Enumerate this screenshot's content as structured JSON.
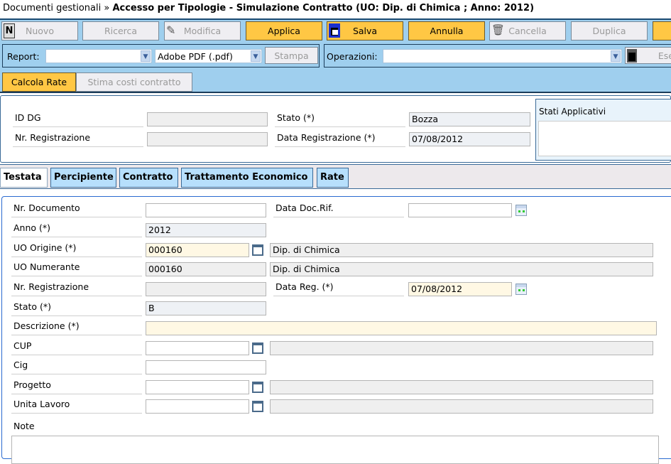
{
  "title": {
    "prefix": "Documenti gestionali »",
    "main": "Accesso per Tipologie - Simulazione Contratto (UO: Dip. di Chimica ; Anno: 2012)"
  },
  "toolbar": {
    "nuovo": "Nuovo",
    "ricerca": "Ricerca",
    "modifica": "Modifica",
    "applica": "Applica",
    "salva": "Salva",
    "annulla": "Annulla",
    "cancella": "Cancella",
    "duplica": "Duplica",
    "report_label": "Report:",
    "report_value": "",
    "format_value": "Adobe PDF (.pdf)",
    "stampa": "Stampa",
    "operazioni_label": "Operazioni:",
    "operazioni_value": "",
    "esegui": "Ese",
    "calcola_rate": "Calcola Rate",
    "stima_costi": "Stima costi contratto"
  },
  "header": {
    "id_dg_label": "ID DG",
    "id_dg": "",
    "nr_reg_label": "Nr. Registrazione",
    "nr_reg": "",
    "stato_label": "Stato (*)",
    "stato": "Bozza",
    "data_reg_label": "Data Registrazione (*)",
    "data_reg": "07/08/2012",
    "stati_label": "Stati Applicativi"
  },
  "tabs": [
    "Testata",
    "Percipiente",
    "Contratto",
    "Trattamento Economico",
    "Rate"
  ],
  "form": {
    "nr_documento_label": "Nr. Documento",
    "nr_documento": "",
    "data_doc_rif_label": "Data Doc.Rif.",
    "data_doc_rif": "",
    "anno_label": "Anno (*)",
    "anno": "2012",
    "uo_origine_label": "UO Origine (*)",
    "uo_origine": "000160",
    "uo_origine_desc": "Dip. di Chimica",
    "uo_numerante_label": "UO Numerante",
    "uo_numerante": "000160",
    "uo_numerante_desc": "Dip. di Chimica",
    "nr_reg_label": "Nr. Registrazione",
    "nr_reg": "",
    "data_reg_label": "Data Reg. (*)",
    "data_reg": "07/08/2012",
    "stato_label": "Stato (*)",
    "stato": "B",
    "descrizione_label": "Descrizione (*)",
    "descrizione": "",
    "cup_label": "CUP",
    "cup": "",
    "cig_label": "Cig",
    "cig": "",
    "progetto_label": "Progetto",
    "progetto": "",
    "unita_lavoro_label": "Unita Lavoro",
    "unita_lavoro": "",
    "note_label": "Note",
    "note": ""
  },
  "colors": {
    "toolbar_bg": "#9fcfee",
    "accent": "#ffc744",
    "tab_bg": "#b7dffc"
  }
}
